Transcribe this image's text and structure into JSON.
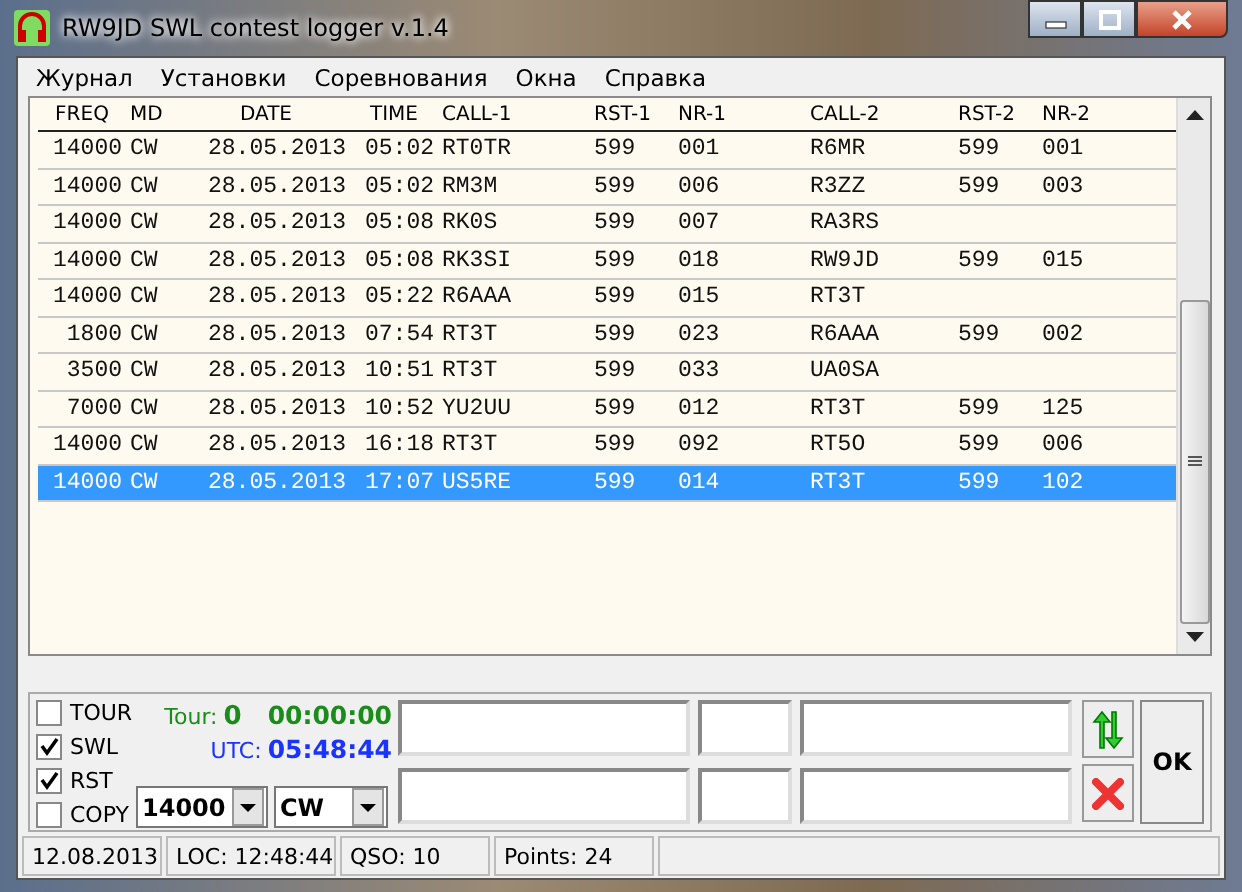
{
  "window": {
    "title": "RW9JD SWL contest logger v.1.4"
  },
  "menu": [
    "Журнал",
    "Установки",
    "Соревнования",
    "Окна",
    "Справка"
  ],
  "table": {
    "columns": [
      "FREQ",
      "MD",
      "DATE",
      "TIME",
      "CALL-1",
      "RST-1",
      "NR-1",
      "CALL-2",
      "RST-2",
      "NR-2"
    ],
    "rows": [
      {
        "cells": [
          "14000",
          "CW",
          "28.05.2013",
          "05:02",
          "RT0TR",
          "599",
          "001",
          "R6MR",
          "599",
          "001"
        ],
        "selected": false
      },
      {
        "cells": [
          "14000",
          "CW",
          "28.05.2013",
          "05:02",
          "RM3M",
          "599",
          "006",
          "R3ZZ",
          "599",
          "003"
        ],
        "selected": false
      },
      {
        "cells": [
          "14000",
          "CW",
          "28.05.2013",
          "05:08",
          "RK0S",
          "599",
          "007",
          "RA3RS",
          "",
          ""
        ],
        "selected": false
      },
      {
        "cells": [
          "14000",
          "CW",
          "28.05.2013",
          "05:08",
          "RK3SI",
          "599",
          "018",
          "RW9JD",
          "599",
          "015"
        ],
        "selected": false
      },
      {
        "cells": [
          "14000",
          "CW",
          "28.05.2013",
          "05:22",
          "R6AAA",
          "599",
          "015",
          "RT3T",
          "",
          ""
        ],
        "selected": false
      },
      {
        "cells": [
          "1800",
          "CW",
          "28.05.2013",
          "07:54",
          "RT3T",
          "599",
          "023",
          "R6AAA",
          "599",
          "002"
        ],
        "selected": false
      },
      {
        "cells": [
          "3500",
          "CW",
          "28.05.2013",
          "10:51",
          "RT3T",
          "599",
          "033",
          "UA0SA",
          "",
          ""
        ],
        "selected": false
      },
      {
        "cells": [
          "7000",
          "CW",
          "28.05.2013",
          "10:52",
          "YU2UU",
          "599",
          "012",
          "RT3T",
          "599",
          "125"
        ],
        "selected": false
      },
      {
        "cells": [
          "14000",
          "CW",
          "28.05.2013",
          "16:18",
          "RT3T",
          "599",
          "092",
          "RT5O",
          "599",
          "006"
        ],
        "selected": false
      },
      {
        "cells": [
          "14000",
          "CW",
          "28.05.2013",
          "17:07",
          "US5RE",
          "599",
          "014",
          "RT3T",
          "599",
          "102"
        ],
        "selected": true
      }
    ]
  },
  "options": [
    {
      "label": "TOUR",
      "checked": false
    },
    {
      "label": "SWL",
      "checked": true
    },
    {
      "label": "RST",
      "checked": true
    },
    {
      "label": "COPY",
      "checked": false
    }
  ],
  "tour": {
    "label": "Tour:",
    "value": "0",
    "timer": "00:00:00"
  },
  "utc": {
    "label": "UTC:",
    "time": "05:48:44"
  },
  "band": "14000",
  "mode": "CW",
  "ok_button": "OK",
  "status_bar": [
    "12.08.2013",
    "LOC: 12:48:44",
    "QSO: 10",
    "Points: 24"
  ]
}
